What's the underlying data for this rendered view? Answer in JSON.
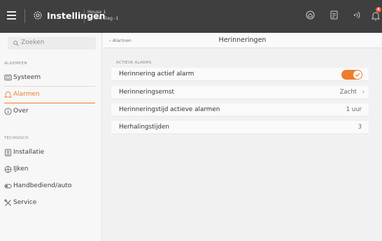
{
  "topbar": {
    "title": "Instellingen",
    "context_line1": "House 1",
    "context_line2": "12:34, Dag -1",
    "notification_count": "6",
    "icons": [
      "menu-icon",
      "gear-icon",
      "home-icon",
      "document-icon",
      "signal-icon",
      "bell-icon"
    ]
  },
  "sidebar": {
    "search_placeholder": "Zoeken",
    "sections": {
      "general": "ALGEMEEN",
      "technical": "TECHNISCH"
    },
    "items": [
      {
        "label": "Systeem",
        "icon": "monitor-icon"
      },
      {
        "label": "Alarmen",
        "icon": "alarm-bell-icon",
        "active": true
      },
      {
        "label": "Over",
        "icon": "info-icon"
      },
      {
        "label": "Installatie",
        "icon": "installation-icon"
      },
      {
        "label": "IJken",
        "icon": "target-icon"
      },
      {
        "label": "Handbediend/auto",
        "icon": "toggle-icon"
      },
      {
        "label": "Service",
        "icon": "tools-icon"
      }
    ]
  },
  "main": {
    "back_label": "Alarmen",
    "title": "Herinneringen",
    "group_label": "ACTIEVE ALARMS",
    "rows": [
      {
        "label": "Herinnering actief alarm",
        "type": "toggle",
        "on": true
      },
      {
        "label": "Herinneringsernst",
        "value": "Zacht",
        "type": "select"
      },
      {
        "label": "Herinneringstijd actieve alarmen",
        "value": "1 uur",
        "type": "value"
      },
      {
        "label": "Herhalingstijden",
        "value": "3",
        "type": "value"
      }
    ]
  },
  "colors": {
    "accent": "#ef7d2e",
    "topbar": "#3f3f3f",
    "badge": "#e8553f"
  }
}
